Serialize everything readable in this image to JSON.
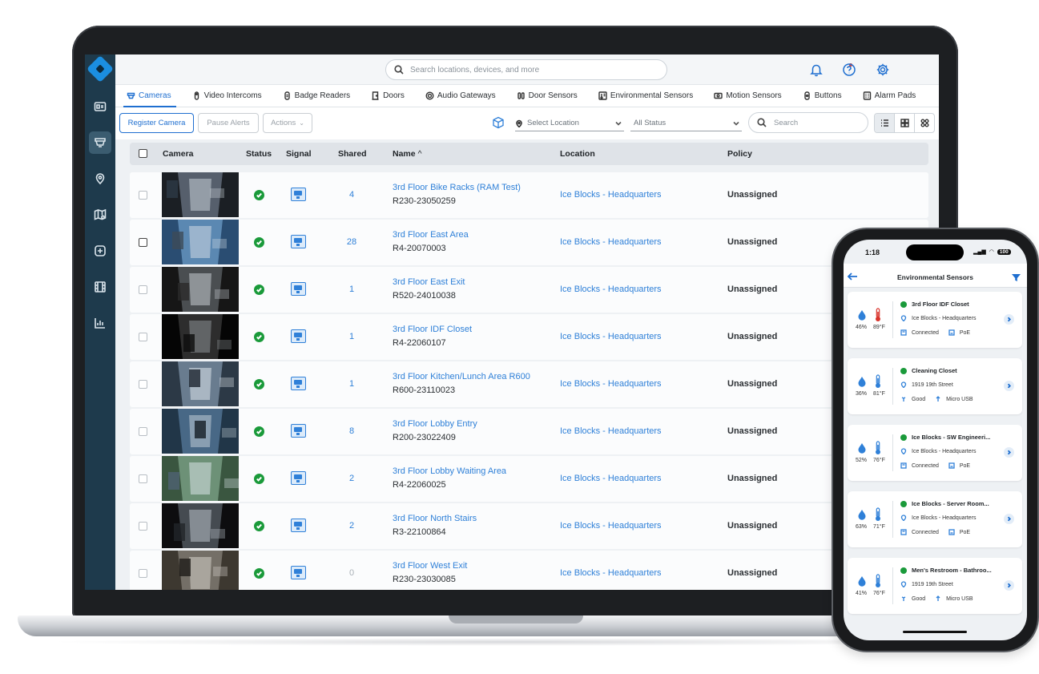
{
  "search": {
    "placeholder": "Search locations, devices, and more"
  },
  "tabs": [
    {
      "label": "Cameras",
      "icon": "camera-icon",
      "active": true
    },
    {
      "label": "Video Intercoms",
      "icon": "intercom-icon"
    },
    {
      "label": "Badge Readers",
      "icon": "badge-reader-icon"
    },
    {
      "label": "Doors",
      "icon": "door-icon"
    },
    {
      "label": "Audio Gateways",
      "icon": "audio-gateway-icon"
    },
    {
      "label": "Door Sensors",
      "icon": "door-sensor-icon"
    },
    {
      "label": "Environmental Sensors",
      "icon": "environmental-sensor-icon"
    },
    {
      "label": "Motion Sensors",
      "icon": "motion-sensor-icon"
    },
    {
      "label": "Buttons",
      "icon": "button-icon"
    },
    {
      "label": "Alarm Pads",
      "icon": "alarm-pad-icon"
    }
  ],
  "toolbar": {
    "register_label": "Register Camera",
    "pause_label": "Pause Alerts",
    "actions_label": "Actions",
    "location_placeholder": "Select Location",
    "status_value": "All Status",
    "search_placeholder": "Search"
  },
  "table": {
    "columns": {
      "camera": "Camera",
      "status": "Status",
      "signal": "Signal",
      "shared": "Shared",
      "name": "Name",
      "location": "Location",
      "policy": "Policy"
    },
    "rows": [
      {
        "name": "3rd Floor Bike Racks (RAM Test)",
        "serial": "R230-23050259",
        "shared": "4",
        "location": "Ice Blocks - Headquarters",
        "policy": "Unassigned"
      },
      {
        "name": "3rd Floor East Area",
        "serial": "R4-20070003",
        "shared": "28",
        "location": "Ice Blocks - Headquarters",
        "policy": "Unassigned"
      },
      {
        "name": "3rd Floor East Exit",
        "serial": "R520-24010038",
        "shared": "1",
        "location": "Ice Blocks - Headquarters",
        "policy": "Unassigned"
      },
      {
        "name": "3rd Floor IDF Closet",
        "serial": "R4-22060107",
        "shared": "1",
        "location": "Ice Blocks - Headquarters",
        "policy": "Unassigned"
      },
      {
        "name": "3rd Floor Kitchen/Lunch Area R600",
        "serial": "R600-23110023",
        "shared": "1",
        "location": "Ice Blocks - Headquarters",
        "policy": "Unassigned"
      },
      {
        "name": "3rd Floor Lobby Entry",
        "serial": "R200-23022409",
        "shared": "8",
        "location": "Ice Blocks - Headquarters",
        "policy": "Unassigned"
      },
      {
        "name": "3rd Floor Lobby Waiting Area",
        "serial": "R4-22060025",
        "shared": "2",
        "location": "Ice Blocks - Headquarters",
        "policy": "Unassigned"
      },
      {
        "name": "3rd Floor North Stairs",
        "serial": "R3-22100864",
        "shared": "2",
        "location": "Ice Blocks - Headquarters",
        "policy": "Unassigned"
      },
      {
        "name": "3rd Floor West Exit",
        "serial": "R230-23030085",
        "shared": "0",
        "location": "Ice Blocks - Headquarters",
        "policy": "Unassigned"
      }
    ]
  },
  "phone": {
    "time": "1:18",
    "battery": "100",
    "title": "Environmental Sensors",
    "cards": [
      {
        "name": "3rd Floor IDF Closet",
        "humidity": "46%",
        "temp": "89°F",
        "location": "Ice Blocks - Headquarters",
        "conn": "Connected",
        "power": "PoE",
        "temp_color": "#d9342b"
      },
      {
        "name": "Cleaning Closet",
        "humidity": "36%",
        "temp": "81°F",
        "location": "1919 19th Street",
        "conn": "Good",
        "power": "Micro USB",
        "temp_color": "#2f80d8"
      },
      {
        "name": "Ice Blocks - SW Engineeri...",
        "humidity": "52%",
        "temp": "76°F",
        "location": "Ice Blocks - Headquarters",
        "conn": "Connected",
        "power": "PoE",
        "temp_color": "#2f80d8"
      },
      {
        "name": "Ice Blocks - Server Room...",
        "humidity": "63%",
        "temp": "71°F",
        "location": "Ice Blocks - Headquarters",
        "conn": "Connected",
        "power": "PoE",
        "temp_color": "#2f80d8"
      },
      {
        "name": "Men's Restroom - Bathroo...",
        "humidity": "41%",
        "temp": "76°F",
        "location": "1919 19th Street",
        "conn": "Good",
        "power": "Micro USB",
        "temp_color": "#2f80d8"
      }
    ]
  },
  "colors": {
    "accent": "#1f6fd0",
    "sidebar": "#1e3a4c",
    "ok": "#1a9a3a"
  }
}
